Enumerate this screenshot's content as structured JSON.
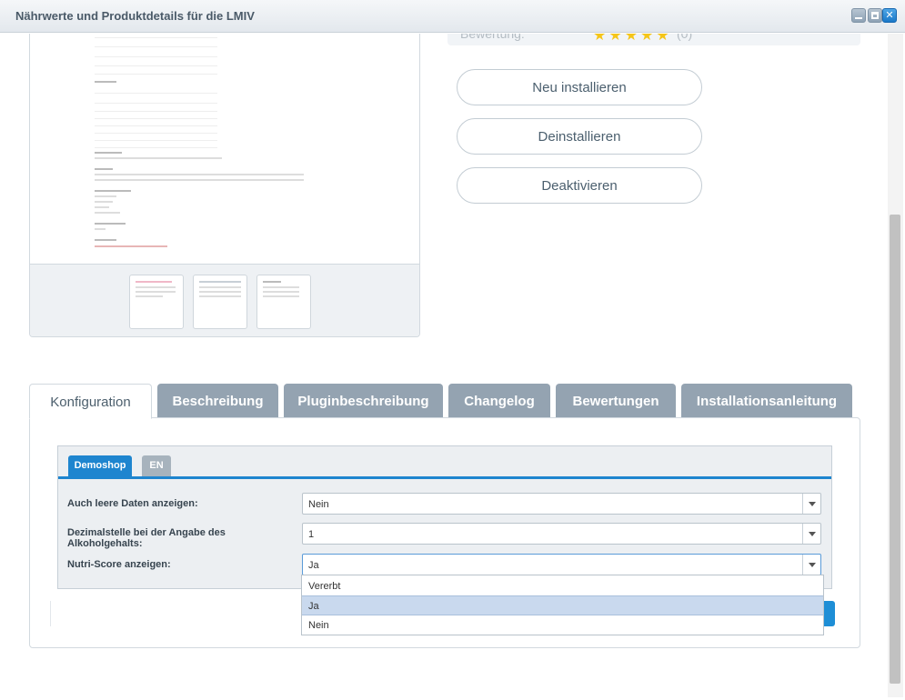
{
  "window": {
    "title": "Nährwerte und Produktdetails für die LMIV",
    "controls": [
      "minimize",
      "maximize",
      "close"
    ]
  },
  "rating": {
    "label": "Bewertung:",
    "stars": "★★★★★",
    "count": "(0)"
  },
  "actions": {
    "reinstall": "Neu installieren",
    "uninstall": "Deinstallieren",
    "deactivate": "Deaktivieren"
  },
  "tabs": [
    {
      "label": "Konfiguration"
    },
    {
      "label": "Beschreibung"
    },
    {
      "label": "Pluginbeschreibung"
    },
    {
      "label": "Changelog"
    },
    {
      "label": "Bewertungen"
    },
    {
      "label": "Installationsanleitung"
    }
  ],
  "shop_tabs": {
    "active": "Demoshop",
    "other": "EN"
  },
  "fields": [
    {
      "label": "Auch leere Daten anzeigen:",
      "value": "Nein"
    },
    {
      "label": "Dezimalstelle bei der Angabe des Alkoholgehalts:",
      "value": "1"
    },
    {
      "label": "Nutri-Score anzeigen:",
      "value": "Ja"
    }
  ],
  "dropdown": {
    "options": [
      "Vererbt",
      "Ja",
      "Nein"
    ],
    "selected": "Ja"
  },
  "colors": {
    "accent": "#1e85cf",
    "tab_inactive": "#94a3b1",
    "option_highlight": "#c9d9ee"
  }
}
